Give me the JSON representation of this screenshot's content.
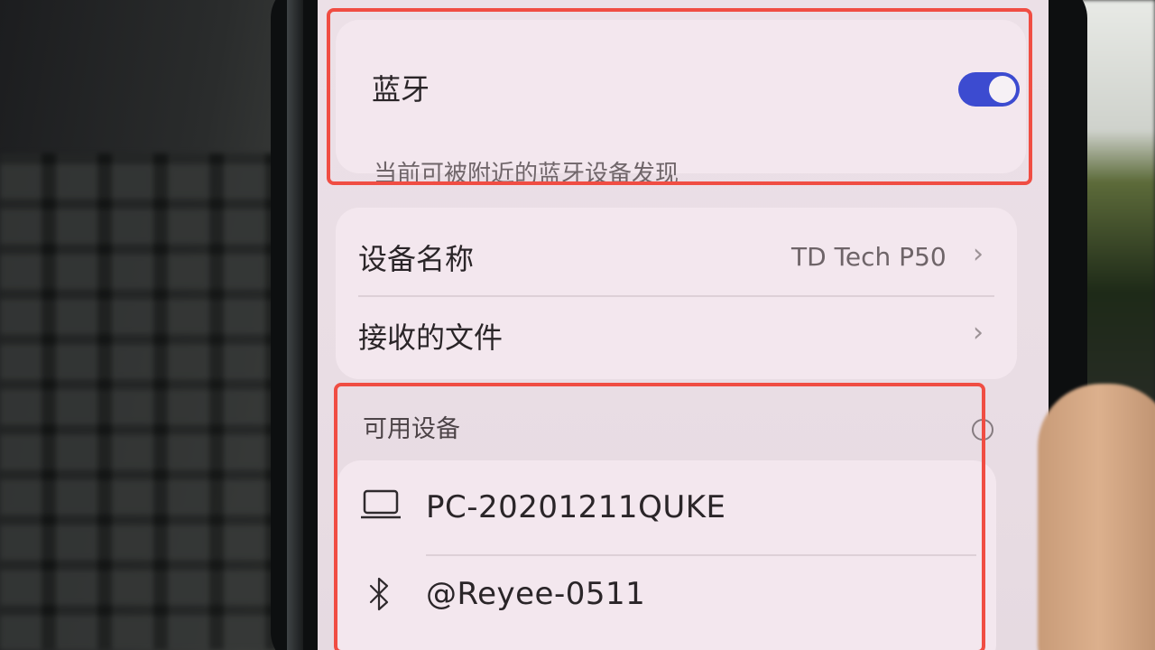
{
  "bluetooth": {
    "title": "蓝牙",
    "enabled": true,
    "description": "当前可被附近的蓝牙设备发现",
    "toggle_color": "#3c4bd0"
  },
  "settings": {
    "device_name_label": "设备名称",
    "device_name_value": "TD Tech P50",
    "received_files_label": "接收的文件"
  },
  "available_devices": {
    "title": "可用设备",
    "devices": [
      {
        "name": "PC-20201211QUKE",
        "icon": "laptop-icon"
      },
      {
        "name": "@Reyee-0511",
        "icon": "bluetooth-icon"
      }
    ]
  },
  "annotation": {
    "highlight_color": "#f04d43"
  }
}
